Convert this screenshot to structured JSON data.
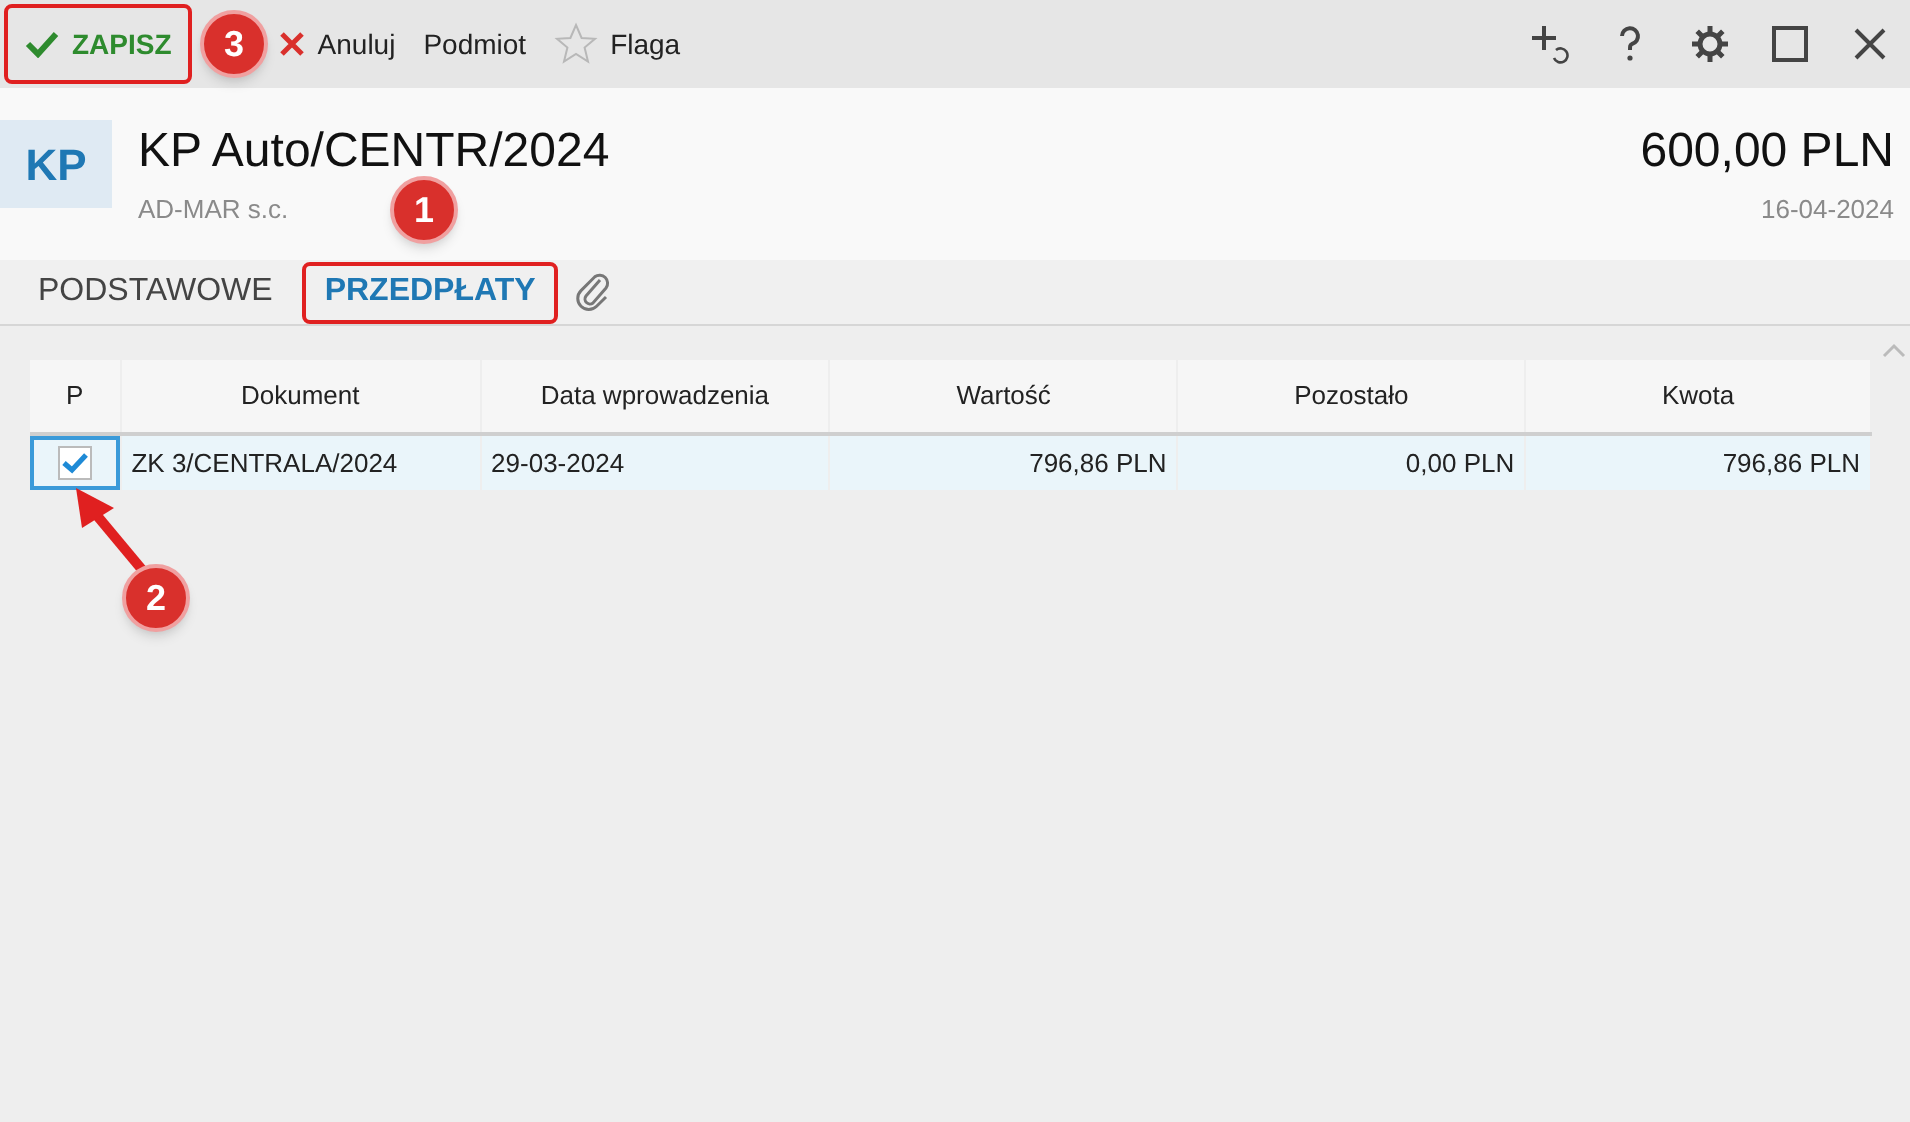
{
  "toolbar": {
    "buttons": [
      {
        "kind": "save",
        "label": "ZAPISZ",
        "outlined": true
      },
      {
        "kind": "cancel",
        "label": "Anuluj",
        "outlined": false
      },
      {
        "kind": "plain",
        "label": "Podmiot",
        "outlined": false
      },
      {
        "kind": "flag",
        "label": "Flaga",
        "outlined": false
      }
    ]
  },
  "document": {
    "badge": "KP",
    "title": "KP Auto/CENTR/2024",
    "subtitle": "AD-MAR s.c.",
    "amount": "600,00 PLN",
    "date": "16-04-2024"
  },
  "tabs": [
    {
      "label": "PODSTAWOWE",
      "selected": false,
      "outlined": false
    },
    {
      "label": "PRZEDPŁATY",
      "selected": true,
      "outlined": true
    }
  ],
  "table": {
    "columns": [
      "P",
      "Dokument",
      "Data wprowadzenia",
      "Wartość",
      "Pozostało",
      "Kwota"
    ],
    "rows": [
      {
        "checked": true,
        "selected": true,
        "cells": [
          "",
          "ZK 3/CENTRALA/2024",
          "29-03-2024",
          "796,86 PLN",
          "0,00 PLN",
          "796,86 PLN"
        ]
      }
    ]
  },
  "annotations": [
    {
      "number": "1"
    },
    {
      "number": "2"
    },
    {
      "number": "3"
    }
  ]
}
